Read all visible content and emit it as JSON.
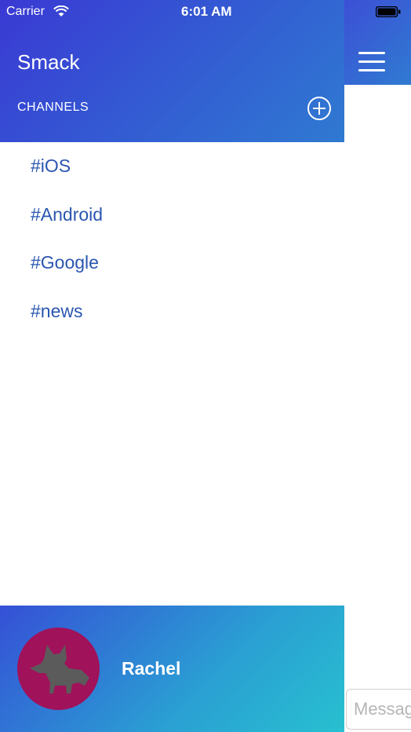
{
  "status_bar": {
    "carrier": "Carrier",
    "time": "6:01 AM"
  },
  "menu": {
    "title": "Smack",
    "channels_label": "CHANNELS",
    "add_icon": "plus-circle-icon",
    "channels": [
      {
        "label": "#iOS"
      },
      {
        "label": "#Android"
      },
      {
        "label": "#Google"
      },
      {
        "label": "#news"
      }
    ],
    "user": {
      "name": "Rachel",
      "avatar_icon": "fox-icon",
      "avatar_color": "#a0125a"
    }
  },
  "main": {
    "menu_icon": "hamburger-icon",
    "message_placeholder": "Message"
  },
  "colors": {
    "header_gradient_start": "#3a39d3",
    "header_gradient_end": "#2f7ad1",
    "channel_text": "#2a56b0",
    "footer_gradient_end": "#28c0d0"
  }
}
